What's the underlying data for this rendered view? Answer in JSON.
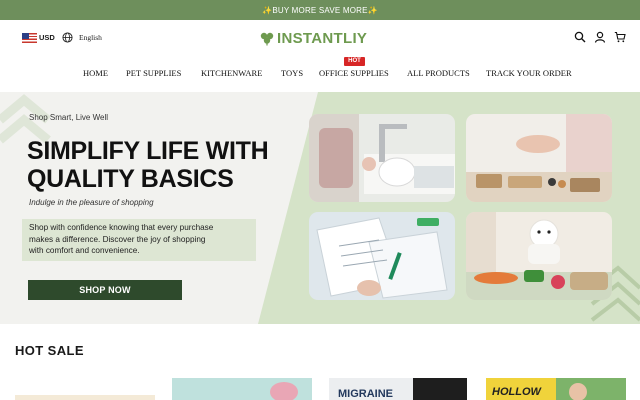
{
  "announcement": "✨BUY MORE SAVE MORE✨",
  "topbar": {
    "currency": "USD",
    "language": "English",
    "logo_text": "INSTANTLIY"
  },
  "nav": {
    "items": [
      "HOME",
      "PET SUPPLIES",
      "KITCHENWARE",
      "TOYS",
      "OFFICE SUPPLIES",
      "ALL PRODUCTS",
      "TRACK YOUR ORDER"
    ],
    "badge": "HOT"
  },
  "hero": {
    "kicker": "Shop Smart, Live Well",
    "title_line1": "SIMPLIFY LIFE WITH",
    "title_line2": "QUALITY BASICS",
    "subtitle": "Indulge in the pleasure of shopping",
    "desc_line1": "Shop with confidence knowing that every purchase",
    "desc_line2": "makes a difference. Discover the joy of shopping",
    "desc_line3": "with comfort and convenience.",
    "cta": "SHOP NOW"
  },
  "section": {
    "title": "HOT SALE"
  },
  "products": [
    {
      "visible_text": ""
    },
    {
      "visible_text": ""
    },
    {
      "visible_text": "MIGRAINE"
    },
    {
      "visible_text": "HOLLOW"
    }
  ],
  "colors": {
    "brand_green": "#6e9a4f",
    "announce_bg": "#6e8f5c",
    "cta_bg": "#2e4a2c",
    "hero_panel": "#d5e3c8",
    "hot_badge": "#d72626"
  }
}
